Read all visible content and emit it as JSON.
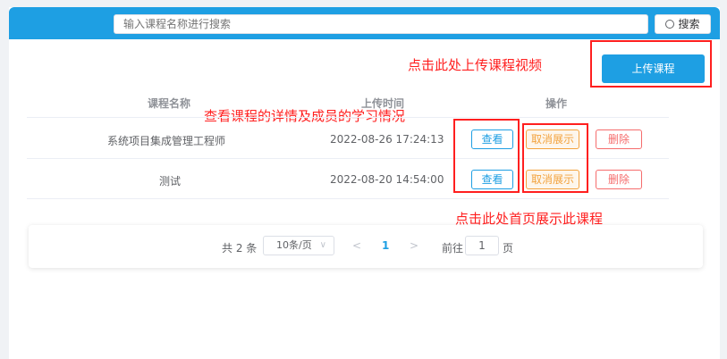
{
  "search": {
    "placeholder": "输入课程名称进行搜索",
    "button_label": "搜索"
  },
  "upload_button": "上传课程",
  "table": {
    "headers": [
      "课程名称",
      "上传时间",
      "操作"
    ],
    "rows": [
      {
        "name": "系统项目集成管理工程师",
        "time": "2022-08-26 17:24:13",
        "view": "查看",
        "hide": "取消展示",
        "delete": "删除"
      },
      {
        "name": "测试",
        "time": "2022-08-20 14:54:00",
        "view": "查看",
        "hide": "取消展示",
        "delete": "删除"
      }
    ]
  },
  "pagination": {
    "total": "共 2 条",
    "page_size": "10条/页",
    "prev": "<",
    "current_page": "1",
    "next": ">",
    "goto_label": "前往",
    "goto_value": "1",
    "goto_unit": "页"
  },
  "annotations": {
    "upload": "点击此处上传课程视频",
    "view": "查看课程的详情及成员的学习情况",
    "homepage": "点击此处首页展示此课程"
  },
  "colors": {
    "accent": "#1e9fe3",
    "warning": "#f3a23d",
    "danger": "#f56c6c",
    "annotation": "#ff1f1f"
  }
}
